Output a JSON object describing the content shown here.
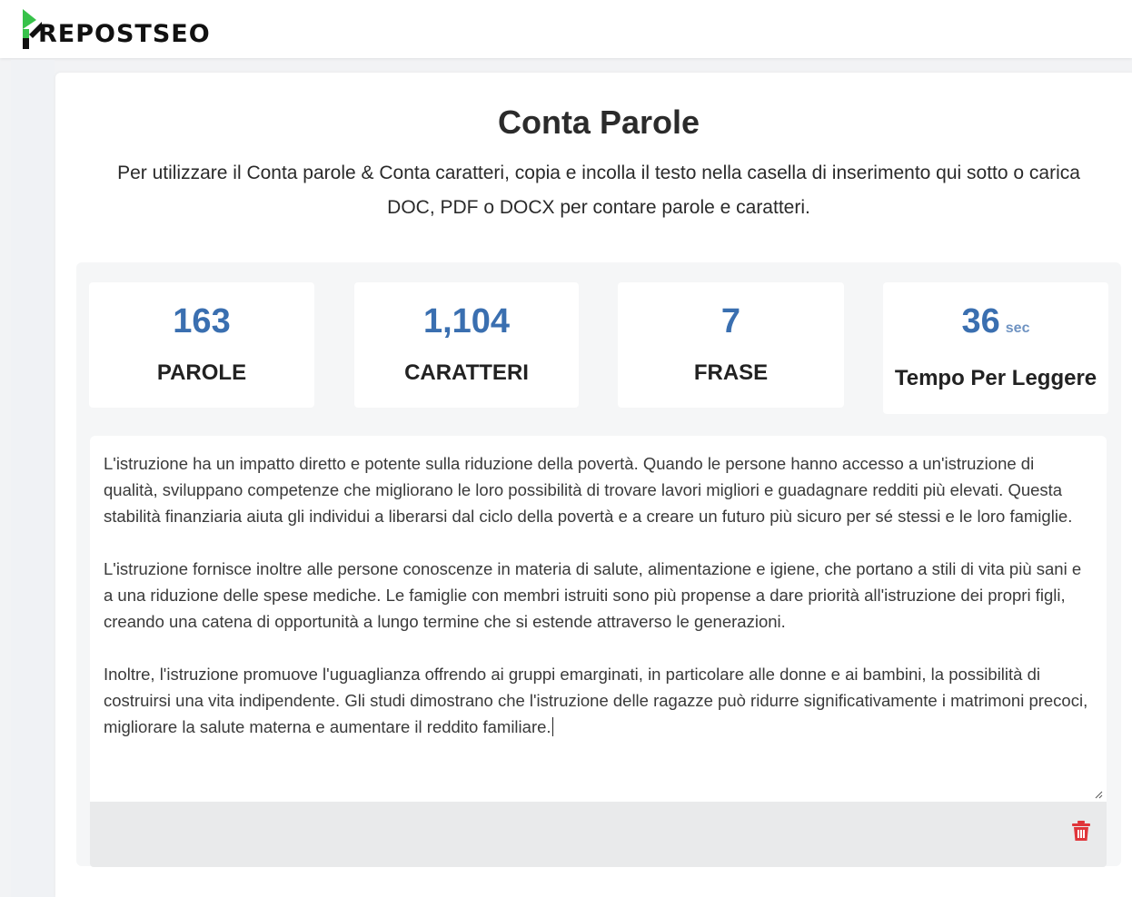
{
  "header": {
    "brand": "REPOSTSEO",
    "brand_color": "#37c24a"
  },
  "tool": {
    "title": "Conta Parole",
    "description": "Per utilizzare il Conta parole & Conta caratteri, copia e incolla il testo nella casella di inserimento qui sotto o carica DOC, PDF o DOCX per contare parole e caratteri."
  },
  "stats": [
    {
      "value": "163",
      "unit": "",
      "label": "PAROLE"
    },
    {
      "value": "1,104",
      "unit": "",
      "label": "CARATTERI"
    },
    {
      "value": "7",
      "unit": "",
      "label": "FRASE"
    },
    {
      "value": "36",
      "unit": "sec",
      "label": "Tempo Per Leggere"
    }
  ],
  "editor": {
    "paragraphs": [
      "L'istruzione ha un impatto diretto e potente sulla riduzione della povertà. Quando le persone hanno accesso a un'istruzione di qualità, sviluppano competenze che migliorano le loro possibilità di trovare lavori migliori e guadagnare redditi più elevati. Questa stabilità finanziaria aiuta gli individui a liberarsi dal ciclo della povertà e a creare un futuro più sicuro per sé stessi e le loro famiglie.",
      "L'istruzione fornisce inoltre alle persone conoscenze in materia di salute, alimentazione e igiene, che portano a stili di vita più sani e a una riduzione delle spese mediche. Le famiglie con membri istruiti sono più propense a dare priorità all'istruzione dei propri figli, creando una catena di opportunità a lungo termine che si estende attraverso le generazioni.",
      "Inoltre, l'istruzione promuove l'uguaglianza offrendo ai gruppi emarginati, in particolare alle donne e ai bambini, la possibilità di costruirsi una vita indipendente. Gli studi dimostrano che l'istruzione delle ragazze può ridurre significativamente i matrimoni precoci, migliorare la salute materna e aumentare il reddito familiare."
    ]
  },
  "icons": {
    "delete": "trash-icon",
    "delete_color": "#e0353a"
  }
}
